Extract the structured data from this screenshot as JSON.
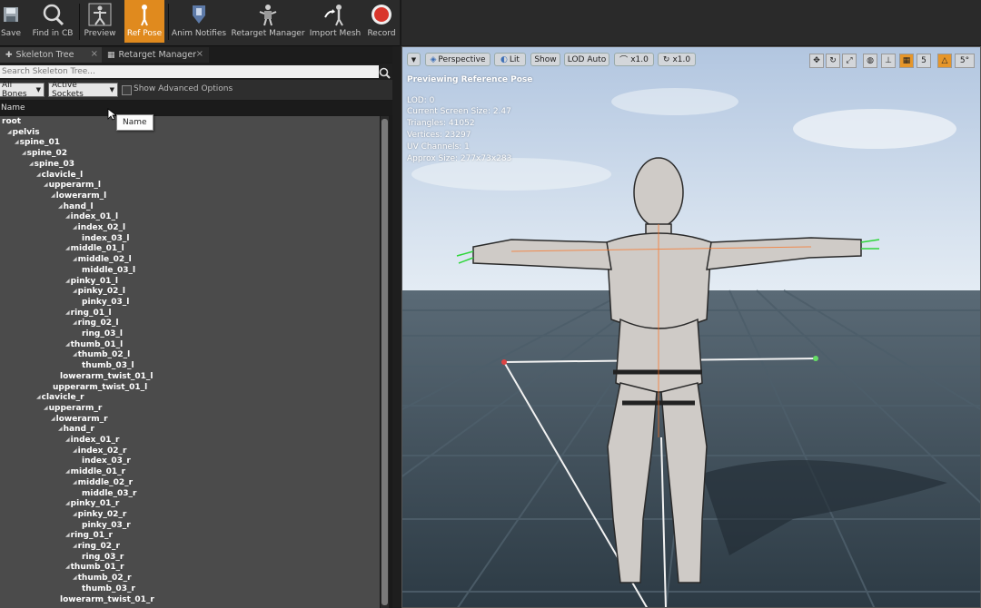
{
  "toolbar": {
    "buttons": [
      {
        "label": "Save",
        "icon": "save-icon"
      },
      {
        "label": "Find in CB",
        "icon": "find-in-cb-icon"
      },
      {
        "label": "Preview",
        "icon": "preview-icon"
      },
      {
        "label": "Ref Pose",
        "icon": "ref-pose-icon"
      },
      {
        "label": "Anim Notifies",
        "icon": "anim-notifies-icon"
      },
      {
        "label": "Retarget Manager",
        "icon": "retarget-manager-icon"
      },
      {
        "label": "Import Mesh",
        "icon": "import-mesh-icon"
      },
      {
        "label": "Record",
        "icon": "record-icon"
      }
    ],
    "active": "Ref Pose",
    "accent": "#e08a1e"
  },
  "tabs": [
    {
      "label": "Skeleton Tree",
      "icon": "skeleton-tree-icon"
    },
    {
      "label": "Retarget Manager",
      "icon": "retarget-manager-tab-icon"
    }
  ],
  "search": {
    "placeholder": "Search Skeleton Tree..."
  },
  "filters": {
    "bones": "All Bones",
    "sockets": "Active Sockets",
    "advanced_label": "Show Advanced Options"
  },
  "column": {
    "name": "Name"
  },
  "tooltip": {
    "text": "Name"
  },
  "tree": [
    {
      "name": "root",
      "depth": 0,
      "expander": false
    },
    {
      "name": "pelvis",
      "depth": 1,
      "expander": true
    },
    {
      "name": "spine_01",
      "depth": 2,
      "expander": true
    },
    {
      "name": "spine_02",
      "depth": 3,
      "expander": true
    },
    {
      "name": "spine_03",
      "depth": 4,
      "expander": true
    },
    {
      "name": "clavicle_l",
      "depth": 5,
      "expander": true
    },
    {
      "name": "upperarm_l",
      "depth": 6,
      "expander": true
    },
    {
      "name": "lowerarm_l",
      "depth": 7,
      "expander": true
    },
    {
      "name": "hand_l",
      "depth": 8,
      "expander": true
    },
    {
      "name": "index_01_l",
      "depth": 9,
      "expander": true
    },
    {
      "name": "index_02_l",
      "depth": 10,
      "expander": true
    },
    {
      "name": "index_03_l",
      "depth": 11,
      "expander": false
    },
    {
      "name": "middle_01_l",
      "depth": 9,
      "expander": true
    },
    {
      "name": "middle_02_l",
      "depth": 10,
      "expander": true
    },
    {
      "name": "middle_03_l",
      "depth": 11,
      "expander": false
    },
    {
      "name": "pinky_01_l",
      "depth": 9,
      "expander": true
    },
    {
      "name": "pinky_02_l",
      "depth": 10,
      "expander": true
    },
    {
      "name": "pinky_03_l",
      "depth": 11,
      "expander": false
    },
    {
      "name": "ring_01_l",
      "depth": 9,
      "expander": true
    },
    {
      "name": "ring_02_l",
      "depth": 10,
      "expander": true
    },
    {
      "name": "ring_03_l",
      "depth": 11,
      "expander": false
    },
    {
      "name": "thumb_01_l",
      "depth": 9,
      "expander": true
    },
    {
      "name": "thumb_02_l",
      "depth": 10,
      "expander": true
    },
    {
      "name": "thumb_03_l",
      "depth": 11,
      "expander": false
    },
    {
      "name": "lowerarm_twist_01_l",
      "depth": 8,
      "expander": false
    },
    {
      "name": "upperarm_twist_01_l",
      "depth": 7,
      "expander": false
    },
    {
      "name": "clavicle_r",
      "depth": 5,
      "expander": true
    },
    {
      "name": "upperarm_r",
      "depth": 6,
      "expander": true
    },
    {
      "name": "lowerarm_r",
      "depth": 7,
      "expander": true
    },
    {
      "name": "hand_r",
      "depth": 8,
      "expander": true
    },
    {
      "name": "index_01_r",
      "depth": 9,
      "expander": true
    },
    {
      "name": "index_02_r",
      "depth": 10,
      "expander": true
    },
    {
      "name": "index_03_r",
      "depth": 11,
      "expander": false
    },
    {
      "name": "middle_01_r",
      "depth": 9,
      "expander": true
    },
    {
      "name": "middle_02_r",
      "depth": 10,
      "expander": true
    },
    {
      "name": "middle_03_r",
      "depth": 11,
      "expander": false
    },
    {
      "name": "pinky_01_r",
      "depth": 9,
      "expander": true
    },
    {
      "name": "pinky_02_r",
      "depth": 10,
      "expander": true
    },
    {
      "name": "pinky_03_r",
      "depth": 11,
      "expander": false
    },
    {
      "name": "ring_01_r",
      "depth": 9,
      "expander": true
    },
    {
      "name": "ring_02_r",
      "depth": 10,
      "expander": true
    },
    {
      "name": "ring_03_r",
      "depth": 11,
      "expander": false
    },
    {
      "name": "thumb_01_r",
      "depth": 9,
      "expander": true
    },
    {
      "name": "thumb_02_r",
      "depth": 10,
      "expander": true
    },
    {
      "name": "thumb_03_r",
      "depth": 11,
      "expander": false
    },
    {
      "name": "lowerarm_twist_01_r",
      "depth": 8,
      "expander": false
    }
  ],
  "viewport": {
    "buttons": {
      "perspective": "Perspective",
      "lit": "Lit",
      "show": "Show",
      "lod": "LOD Auto",
      "speed": "x1.0",
      "scale": "x1.0"
    },
    "snap": {
      "grid": "5",
      "angle": "5°"
    },
    "overlay_title": "Previewing Reference Pose",
    "stats": [
      "LOD: 0",
      "Current Screen Size: 2.47",
      "Triangles: 41052",
      "Vertices: 23297",
      "UV Channels: 1",
      "Approx Size: 277x73x283"
    ],
    "colors": {
      "sky_top": "#b9cde6",
      "floor": "#3a4a55"
    }
  }
}
